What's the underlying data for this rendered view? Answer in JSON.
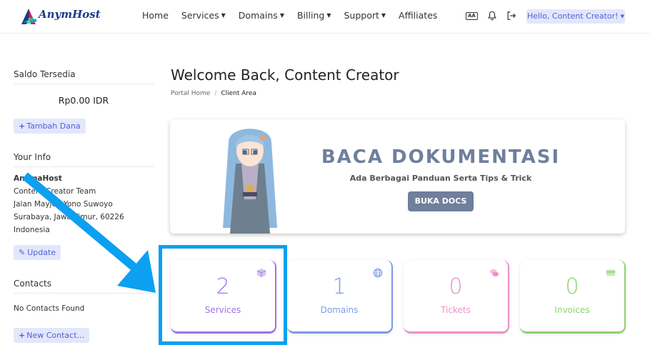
{
  "brand": {
    "name": "AnymHost"
  },
  "nav": {
    "items": [
      {
        "label": "Home",
        "dropdown": false
      },
      {
        "label": "Services",
        "dropdown": true
      },
      {
        "label": "Domains",
        "dropdown": true
      },
      {
        "label": "Billing",
        "dropdown": true
      },
      {
        "label": "Support",
        "dropdown": true
      },
      {
        "label": "Affiliates",
        "dropdown": false
      }
    ],
    "lang_icon_text": "A̅Ā",
    "user_menu": "Hello, Content Creator!"
  },
  "sidebar": {
    "balance_title": "Saldo Tersedia",
    "balance_value": "Rp0.00 IDR",
    "add_funds_label": "Tambah Dana",
    "info_title": "Your Info",
    "info_name": "AnymaHost",
    "info_lines": [
      "Content Creator Team",
      "Jalan Mayjen Yono Suwoyo",
      "Surabaya, Jawa Timur, 60226",
      "Indonesia"
    ],
    "update_label": "Update",
    "contacts_title": "Contacts",
    "contacts_empty": "No Contacts Found",
    "new_contact_label": "New Contact..."
  },
  "main": {
    "title": "Welcome Back, Content Creator",
    "breadcrumb": {
      "home": "Portal Home",
      "current": "Client Area"
    },
    "banner": {
      "title": "BACA DOKUMENTASI",
      "subtitle": "Ada Berbagai Panduan Serta Tips & Trick",
      "button": "BUKA DOCS"
    },
    "stats": [
      {
        "value": "2",
        "label": "Services",
        "color": "#a371e8",
        "icon": "box-icon"
      },
      {
        "value": "1",
        "label": "Domains",
        "color": "#7f9ae6",
        "icon": "globe-icon"
      },
      {
        "value": "0",
        "label": "Tickets",
        "color": "#ee8fc8",
        "icon": "chat-icon"
      },
      {
        "value": "0",
        "label": "Invoices",
        "color": "#8ed36f",
        "icon": "credit-card-icon"
      }
    ]
  },
  "colors": {
    "accent": "#4f5fd9",
    "accent_bg": "#e3e7fb",
    "banner_text": "#6f7f9c",
    "annotation": "#0ba0f0"
  }
}
